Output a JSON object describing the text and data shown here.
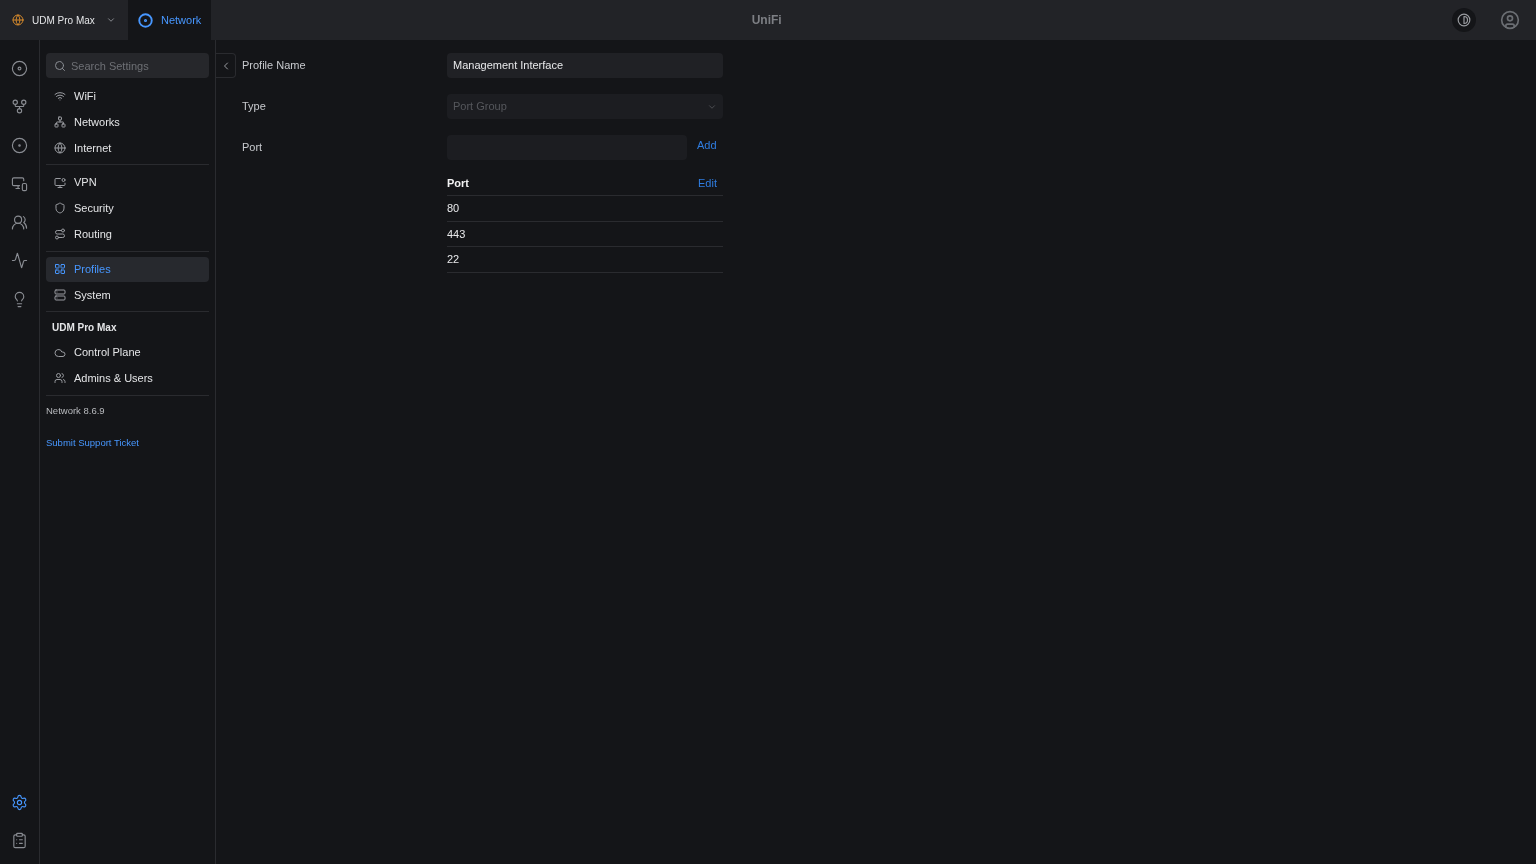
{
  "topbar": {
    "console": "UDM Pro Max",
    "app": {
      "label": "Network",
      "selected": true
    },
    "title": "UniFi"
  },
  "rail": {
    "top": [
      {
        "selected": false
      },
      {
        "selected": false
      },
      {
        "selected": false
      },
      {
        "selected": false
      },
      {
        "selected": false
      },
      {
        "selected": false
      },
      {
        "selected": false
      }
    ],
    "bottom": [
      {
        "selected": true
      },
      {
        "selected": false
      }
    ]
  },
  "sidebar": {
    "search": {
      "placeholder": "Search Settings"
    },
    "groups": [
      {
        "items": [
          {
            "label": "WiFi",
            "selected": false
          },
          {
            "label": "Networks",
            "selected": false
          },
          {
            "label": "Internet",
            "selected": false
          }
        ]
      },
      {
        "items": [
          {
            "label": "VPN",
            "selected": false
          },
          {
            "label": "Security",
            "selected": false
          },
          {
            "label": "Routing",
            "selected": false
          }
        ]
      },
      {
        "items": [
          {
            "label": "Profiles",
            "selected": true
          },
          {
            "label": "System",
            "selected": false
          }
        ]
      },
      {
        "heading": "UDM Pro Max",
        "items": [
          {
            "label": "Control Plane",
            "selected": false
          },
          {
            "label": "Admins & Users",
            "selected": false
          }
        ]
      }
    ],
    "version": "Network 8.6.9",
    "support_link": "Submit Support Ticket"
  },
  "form": {
    "profile_name": {
      "label": "Profile Name",
      "value": "Management Interface"
    },
    "type": {
      "label": "Type",
      "value": "Port Group",
      "disabled": true
    },
    "port": {
      "label": "Port",
      "add": "Add"
    },
    "ports_table": {
      "column": "Port",
      "edit": "Edit",
      "rows": [
        "80",
        "443",
        "22"
      ]
    }
  }
}
